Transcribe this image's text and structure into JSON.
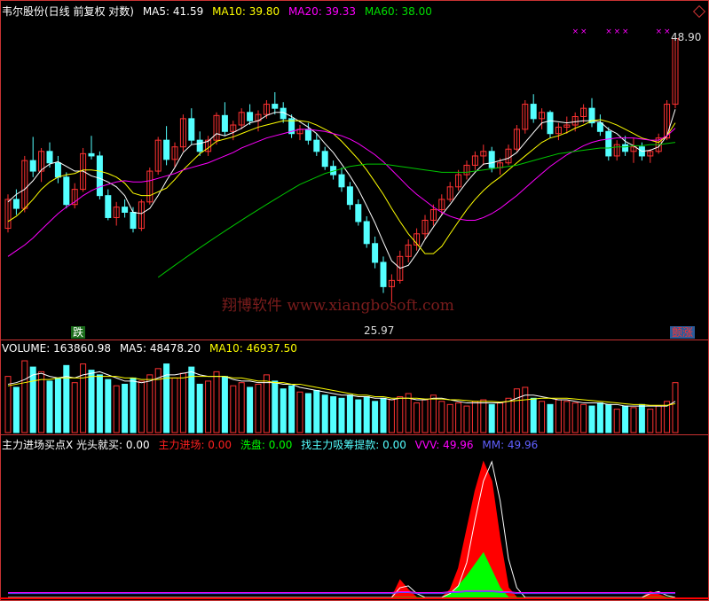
{
  "header": {
    "title": "韦尔股份(日线 前复权 对数)",
    "ma5": "MA5: 41.59",
    "ma10": "MA10: 39.80",
    "ma20": "MA20: 39.33",
    "ma60": "MA60: 38.00"
  },
  "volume_header": {
    "volume": "VOLUME: 163860.98",
    "ma5": "MA5: 48478.20",
    "ma10": "MA10: 46937.50"
  },
  "indicator_header": {
    "name": "主力进场买点X 光头就买: 0.00",
    "zljc": "主力进场: 0.00",
    "xp": "洗盘: 0.00",
    "xszl": "找主力吸筹提款: 0.00",
    "vvv": "VVV: 49.96",
    "mm": "MM: 49.96"
  },
  "annotations": {
    "high_price": "48.90",
    "low_price": "25.97",
    "left_badge": "跌",
    "right_badge": "颤涨",
    "watermark": "翔博软件 www.xiangbosoft.com"
  },
  "colors": {
    "up": "#ff3232",
    "down": "#54ffff",
    "ma5": "#ffffff",
    "ma10": "#ffff00",
    "ma20": "#ff00ff",
    "ma60": "#00c800",
    "zljc": "#ff0000",
    "xp": "#00ff00",
    "xszl": "#54ffff",
    "vvv": "#ff00ff",
    "mm": "#5050ff",
    "axis": "#c83232"
  },
  "chart_data": {
    "type": "candlestick",
    "price_scale": "log",
    "price_range": [
      25,
      50
    ],
    "candles": [
      [
        31.0,
        33.6,
        30.7,
        33.2
      ],
      [
        33.2,
        34.0,
        32.0,
        32.5
      ],
      [
        32.5,
        36.8,
        32.2,
        36.4
      ],
      [
        36.4,
        38.5,
        35.0,
        35.5
      ],
      [
        35.5,
        37.5,
        34.6,
        37.2
      ],
      [
        37.2,
        38.0,
        35.8,
        36.2
      ],
      [
        36.2,
        36.8,
        34.5,
        35.0
      ],
      [
        35.0,
        35.4,
        32.5,
        32.8
      ],
      [
        32.8,
        34.5,
        32.5,
        34.0
      ],
      [
        34.0,
        37.5,
        33.8,
        37.0
      ],
      [
        37.0,
        38.6,
        36.5,
        36.8
      ],
      [
        36.8,
        37.2,
        33.2,
        33.5
      ],
      [
        33.5,
        34.0,
        31.6,
        31.8
      ],
      [
        31.8,
        33.0,
        31.2,
        32.6
      ],
      [
        32.6,
        33.2,
        31.8,
        32.2
      ],
      [
        32.2,
        32.6,
        30.7,
        31.0
      ],
      [
        31.0,
        33.2,
        30.8,
        33.0
      ],
      [
        33.0,
        35.8,
        32.8,
        35.5
      ],
      [
        35.5,
        38.5,
        35.2,
        38.2
      ],
      [
        38.2,
        39.5,
        36.0,
        36.5
      ],
      [
        36.5,
        38.0,
        35.8,
        37.6
      ],
      [
        37.6,
        40.6,
        37.2,
        40.2
      ],
      [
        40.2,
        41.2,
        37.8,
        38.2
      ],
      [
        38.2,
        39.0,
        36.8,
        37.2
      ],
      [
        37.2,
        38.6,
        36.8,
        38.2
      ],
      [
        38.2,
        40.8,
        37.8,
        40.5
      ],
      [
        40.5,
        41.8,
        38.6,
        39.0
      ],
      [
        39.0,
        40.0,
        38.2,
        39.6
      ],
      [
        39.6,
        41.2,
        39.2,
        40.8
      ],
      [
        40.8,
        41.6,
        39.6,
        40.0
      ],
      [
        40.0,
        41.0,
        39.0,
        40.6
      ],
      [
        40.6,
        42.0,
        40.2,
        41.6
      ],
      [
        41.6,
        42.8,
        40.6,
        41.2
      ],
      [
        41.2,
        41.8,
        39.8,
        40.2
      ],
      [
        40.2,
        40.6,
        38.4,
        38.8
      ],
      [
        38.8,
        39.6,
        38.2,
        39.2
      ],
      [
        39.2,
        39.8,
        37.8,
        38.2
      ],
      [
        38.2,
        38.8,
        36.8,
        37.2
      ],
      [
        37.2,
        37.6,
        35.6,
        35.9
      ],
      [
        35.9,
        36.4,
        34.8,
        35.2
      ],
      [
        35.2,
        35.8,
        33.8,
        34.2
      ],
      [
        34.2,
        34.6,
        32.4,
        32.8
      ],
      [
        32.8,
        33.2,
        31.2,
        31.5
      ],
      [
        31.5,
        31.9,
        29.6,
        29.9
      ],
      [
        29.9,
        30.4,
        28.2,
        28.6
      ],
      [
        28.6,
        29.0,
        26.6,
        27.0
      ],
      [
        27.0,
        27.8,
        25.97,
        27.4
      ],
      [
        27.4,
        29.4,
        27.2,
        29.0
      ],
      [
        29.0,
        30.2,
        28.6,
        29.8
      ],
      [
        29.8,
        31.0,
        29.4,
        30.6
      ],
      [
        30.6,
        32.0,
        30.2,
        31.6
      ],
      [
        31.6,
        32.8,
        31.2,
        32.4
      ],
      [
        32.4,
        33.6,
        32.0,
        33.2
      ],
      [
        33.2,
        34.6,
        33.0,
        34.2
      ],
      [
        34.2,
        35.6,
        33.9,
        35.2
      ],
      [
        35.2,
        36.4,
        34.8,
        36.0
      ],
      [
        36.0,
        37.2,
        35.6,
        36.8
      ],
      [
        36.8,
        37.8,
        36.0,
        37.2
      ],
      [
        37.2,
        37.6,
        35.4,
        35.8
      ],
      [
        35.8,
        36.6,
        35.2,
        36.2
      ],
      [
        36.2,
        37.8,
        36.0,
        37.4
      ],
      [
        37.4,
        39.6,
        37.2,
        39.2
      ],
      [
        39.2,
        42.0,
        38.8,
        41.6
      ],
      [
        41.6,
        42.6,
        39.8,
        40.2
      ],
      [
        40.2,
        41.2,
        39.2,
        40.8
      ],
      [
        40.8,
        41.0,
        38.4,
        38.8
      ],
      [
        38.8,
        39.8,
        38.2,
        39.4
      ],
      [
        39.4,
        40.4,
        38.8,
        39.6
      ],
      [
        39.6,
        40.8,
        39.0,
        40.4
      ],
      [
        40.4,
        41.6,
        39.8,
        41.2
      ],
      [
        41.2,
        42.2,
        39.4,
        39.8
      ],
      [
        39.8,
        40.6,
        38.6,
        39.0
      ],
      [
        39.0,
        39.4,
        36.4,
        36.8
      ],
      [
        36.8,
        38.2,
        36.4,
        37.8
      ],
      [
        37.8,
        38.6,
        36.8,
        37.2
      ],
      [
        37.2,
        38.4,
        36.2,
        37.6
      ],
      [
        37.6,
        38.0,
        36.4,
        36.8
      ],
      [
        36.8,
        37.4,
        36.2,
        37.2
      ],
      [
        37.2,
        38.8,
        37.0,
        38.4
      ],
      [
        38.4,
        42.0,
        38.2,
        41.6
      ],
      [
        41.6,
        48.9,
        41.2,
        48.6
      ]
    ],
    "ma_series": [
      {
        "name": "MA5",
        "values": [
          33.0,
          33.6,
          34.0,
          34.7,
          35.6,
          36.1,
          36.3,
          35.9,
          35.5,
          35.5,
          35.1,
          34.9,
          34.6,
          34.2,
          33.5,
          32.2,
          32.1,
          32.5,
          33.5,
          34.7,
          35.8,
          37.1,
          37.8,
          37.9,
          38.1,
          38.8,
          38.6,
          38.9,
          39.3,
          39.8,
          40.0,
          40.5,
          40.8,
          40.8,
          40.4,
          39.9,
          39.4,
          38.8,
          37.9,
          37.1,
          36.1,
          35.1,
          34.0,
          32.7,
          31.4,
          30.0,
          28.7,
          28.2,
          28.4,
          29.2,
          30.2,
          31.1,
          32.0,
          32.8,
          33.7,
          34.6,
          35.4,
          36.1,
          36.2,
          36.4,
          36.6,
          37.1,
          38.0,
          38.9,
          39.8,
          40.0,
          39.9,
          39.8,
          39.9,
          40.0,
          40.0,
          39.9,
          39.2,
          38.8,
          38.1,
          37.7,
          37.2,
          37.3,
          37.6,
          38.6,
          41.1
        ]
      },
      {
        "name": "MA10",
        "values": [
          31.5,
          31.9,
          32.5,
          33.2,
          34.0,
          34.6,
          35.0,
          35.2,
          35.3,
          35.6,
          35.6,
          35.5,
          35.3,
          35.0,
          34.5,
          33.7,
          33.5,
          33.5,
          33.8,
          34.1,
          34.8,
          35.6,
          36.3,
          37.0,
          37.5,
          38.1,
          38.3,
          38.5,
          38.8,
          39.1,
          39.4,
          39.6,
          39.8,
          40.0,
          40.0,
          40.0,
          39.9,
          39.6,
          39.2,
          38.8,
          38.1,
          37.3,
          36.5,
          35.6,
          34.6,
          33.6,
          32.5,
          31.5,
          30.6,
          29.9,
          29.2,
          29.2,
          29.7,
          30.6,
          31.5,
          32.4,
          33.2,
          33.9,
          34.5,
          35.0,
          35.6,
          36.2,
          36.8,
          37.4,
          38.0,
          38.4,
          38.6,
          38.9,
          39.3,
          39.6,
          40.0,
          40.1,
          39.9,
          39.6,
          39.2,
          38.8,
          38.4,
          38.2,
          38.0,
          38.6,
          39.8
        ]
      },
      {
        "name": "MA20",
        "values": [
          29.0,
          29.4,
          29.8,
          30.3,
          30.9,
          31.5,
          32.1,
          32.6,
          33.0,
          33.5,
          33.9,
          34.2,
          34.4,
          34.6,
          34.7,
          34.6,
          34.6,
          34.7,
          34.9,
          35.1,
          35.3,
          35.6,
          35.8,
          36.0,
          36.2,
          36.5,
          36.8,
          37.1,
          37.5,
          37.8,
          38.1,
          38.4,
          38.6,
          38.8,
          39.0,
          39.2,
          39.2,
          39.1,
          39.0,
          38.8,
          38.6,
          38.3,
          37.9,
          37.4,
          36.9,
          36.3,
          35.6,
          34.9,
          34.2,
          33.6,
          33.1,
          32.6,
          32.2,
          31.9,
          31.7,
          31.6,
          31.6,
          31.8,
          32.1,
          32.5,
          33.0,
          33.5,
          34.1,
          34.7,
          35.3,
          35.9,
          36.4,
          36.9,
          37.3,
          37.7,
          38.0,
          38.2,
          38.3,
          38.4,
          38.4,
          38.4,
          38.3,
          38.2,
          38.2,
          38.6,
          39.3
        ]
      },
      {
        "name": "MA60",
        "values": [
          null,
          null,
          null,
          null,
          null,
          null,
          null,
          null,
          null,
          null,
          null,
          null,
          null,
          null,
          null,
          null,
          null,
          null,
          27.6,
          28.0,
          28.4,
          28.8,
          29.2,
          29.6,
          30.0,
          30.4,
          30.8,
          31.2,
          31.6,
          32.0,
          32.4,
          32.8,
          33.2,
          33.6,
          34.0,
          34.4,
          34.7,
          35.0,
          35.3,
          35.5,
          35.7,
          35.9,
          36.0,
          36.1,
          36.1,
          36.1,
          36.0,
          35.9,
          35.8,
          35.7,
          35.6,
          35.5,
          35.4,
          35.4,
          35.4,
          35.4,
          35.5,
          35.6,
          35.7,
          35.8,
          35.9,
          36.0,
          36.2,
          36.4,
          36.6,
          36.8,
          37.0,
          37.1,
          37.2,
          37.3,
          37.4,
          37.5,
          37.5,
          37.6,
          37.6,
          37.7,
          37.7,
          37.8,
          37.8,
          37.9,
          38.0
        ]
      }
    ],
    "volume": [
      72,
      58,
      92,
      84,
      78,
      66,
      70,
      86,
      64,
      88,
      80,
      74,
      68,
      60,
      62,
      70,
      66,
      74,
      82,
      88,
      70,
      76,
      84,
      62,
      66,
      78,
      72,
      60,
      64,
      58,
      62,
      74,
      66,
      56,
      60,
      52,
      50,
      54,
      48,
      46,
      44,
      48,
      42,
      46,
      40,
      44,
      42,
      46,
      50,
      38,
      42,
      48,
      40,
      36,
      38,
      34,
      40,
      42,
      36,
      38,
      44,
      56,
      58,
      44,
      40,
      36,
      42,
      40,
      38,
      36,
      34,
      38,
      36,
      30,
      34,
      32,
      36,
      30,
      34,
      40,
      64
    ],
    "volume_ma5": [
      62,
      64,
      68,
      74,
      76,
      72,
      70,
      72,
      70,
      74,
      76,
      78,
      74,
      70,
      66,
      66,
      64,
      66,
      70,
      74,
      74,
      76,
      78,
      74,
      72,
      72,
      72,
      68,
      66,
      66,
      64,
      64,
      64,
      62,
      62,
      58,
      56,
      54,
      52,
      50,
      48,
      48,
      46,
      46,
      44,
      44,
      42,
      44,
      44,
      42,
      42,
      44,
      44,
      42,
      40,
      38,
      38,
      38,
      38,
      38,
      40,
      44,
      48,
      48,
      46,
      44,
      42,
      42,
      40,
      38,
      38,
      38,
      36,
      36,
      34,
      34,
      34,
      34,
      34,
      34,
      40
    ],
    "volume_ma10": [
      60,
      62,
      64,
      66,
      68,
      68,
      70,
      70,
      70,
      70,
      72,
      72,
      72,
      72,
      70,
      70,
      68,
      68,
      68,
      70,
      70,
      70,
      72,
      72,
      72,
      72,
      72,
      70,
      70,
      68,
      66,
      66,
      64,
      64,
      62,
      62,
      60,
      58,
      56,
      54,
      52,
      50,
      48,
      48,
      46,
      46,
      44,
      44,
      44,
      44,
      43,
      43,
      43,
      42,
      42,
      41,
      40,
      40,
      40,
      39,
      40,
      41,
      42,
      43,
      44,
      44,
      44,
      44,
      43,
      42,
      41,
      40,
      39,
      38,
      37,
      36,
      36,
      35,
      35,
      35,
      37
    ],
    "indicator": {
      "zljc": [
        0,
        0,
        0,
        0,
        0,
        0,
        0,
        0,
        0,
        0,
        0,
        0,
        0,
        0,
        0,
        0,
        0,
        0,
        0,
        0,
        0,
        0,
        0,
        0,
        0,
        0,
        0,
        0,
        0,
        0,
        0,
        0,
        0,
        0,
        0,
        0,
        0,
        0,
        0,
        0,
        0,
        0,
        0,
        0,
        0,
        0,
        0,
        18,
        8,
        0,
        0,
        0,
        0,
        8,
        30,
        70,
        110,
        140,
        120,
        60,
        10,
        0,
        0,
        0,
        0,
        0,
        0,
        0,
        0,
        0,
        0,
        0,
        0,
        0,
        0,
        0,
        0,
        6,
        3,
        0,
        0
      ],
      "xp": [
        0,
        0,
        0,
        0,
        0,
        0,
        0,
        0,
        0,
        0,
        0,
        0,
        0,
        0,
        0,
        0,
        0,
        0,
        0,
        0,
        0,
        0,
        0,
        0,
        0,
        0,
        0,
        0,
        0,
        0,
        0,
        0,
        0,
        0,
        0,
        0,
        0,
        0,
        0,
        0,
        0,
        0,
        0,
        0,
        0,
        0,
        0,
        0,
        0,
        0,
        0,
        0,
        0,
        4,
        12,
        22,
        34,
        46,
        28,
        10,
        0,
        0,
        0,
        0,
        0,
        0,
        0,
        0,
        0,
        0,
        0,
        0,
        0,
        0,
        0,
        0,
        0,
        0,
        0,
        0,
        0
      ],
      "vvv": [
        5,
        5,
        5,
        5,
        5,
        5,
        5,
        5,
        5,
        5,
        5,
        5,
        5,
        5,
        5,
        5,
        5,
        5,
        5,
        5,
        5,
        5,
        5,
        5,
        5,
        5,
        5,
        5,
        5,
        5,
        5,
        5,
        5,
        5,
        5,
        5,
        5,
        5,
        5,
        5,
        5,
        5,
        5,
        5,
        5,
        5,
        5,
        6,
        6,
        5,
        5,
        5,
        5,
        6,
        6,
        7,
        7,
        7,
        7,
        6,
        6,
        5,
        5,
        5,
        5,
        5,
        5,
        5,
        5,
        5,
        5,
        5,
        5,
        5,
        5,
        5,
        5,
        5,
        5,
        5,
        5
      ],
      "line_white": [
        0,
        0,
        0,
        0,
        0,
        0,
        0,
        0,
        0,
        0,
        0,
        0,
        0,
        0,
        0,
        0,
        0,
        0,
        0,
        0,
        0,
        0,
        0,
        0,
        0,
        0,
        0,
        0,
        0,
        0,
        0,
        0,
        0,
        0,
        0,
        0,
        0,
        0,
        0,
        0,
        0,
        0,
        0,
        0,
        0,
        0,
        0,
        10,
        12,
        4,
        0,
        0,
        0,
        4,
        12,
        36,
        80,
        120,
        140,
        100,
        40,
        10,
        0,
        0,
        0,
        0,
        0,
        0,
        0,
        0,
        0,
        0,
        0,
        0,
        0,
        0,
        0,
        4,
        6,
        2,
        0
      ]
    },
    "ma_markers_x": [
      69,
      70,
      73,
      74,
      75,
      79,
      80,
      82,
      84,
      85,
      86,
      87,
      88,
      90,
      92,
      94,
      95,
      96,
      97,
      98,
      100,
      101
    ]
  }
}
